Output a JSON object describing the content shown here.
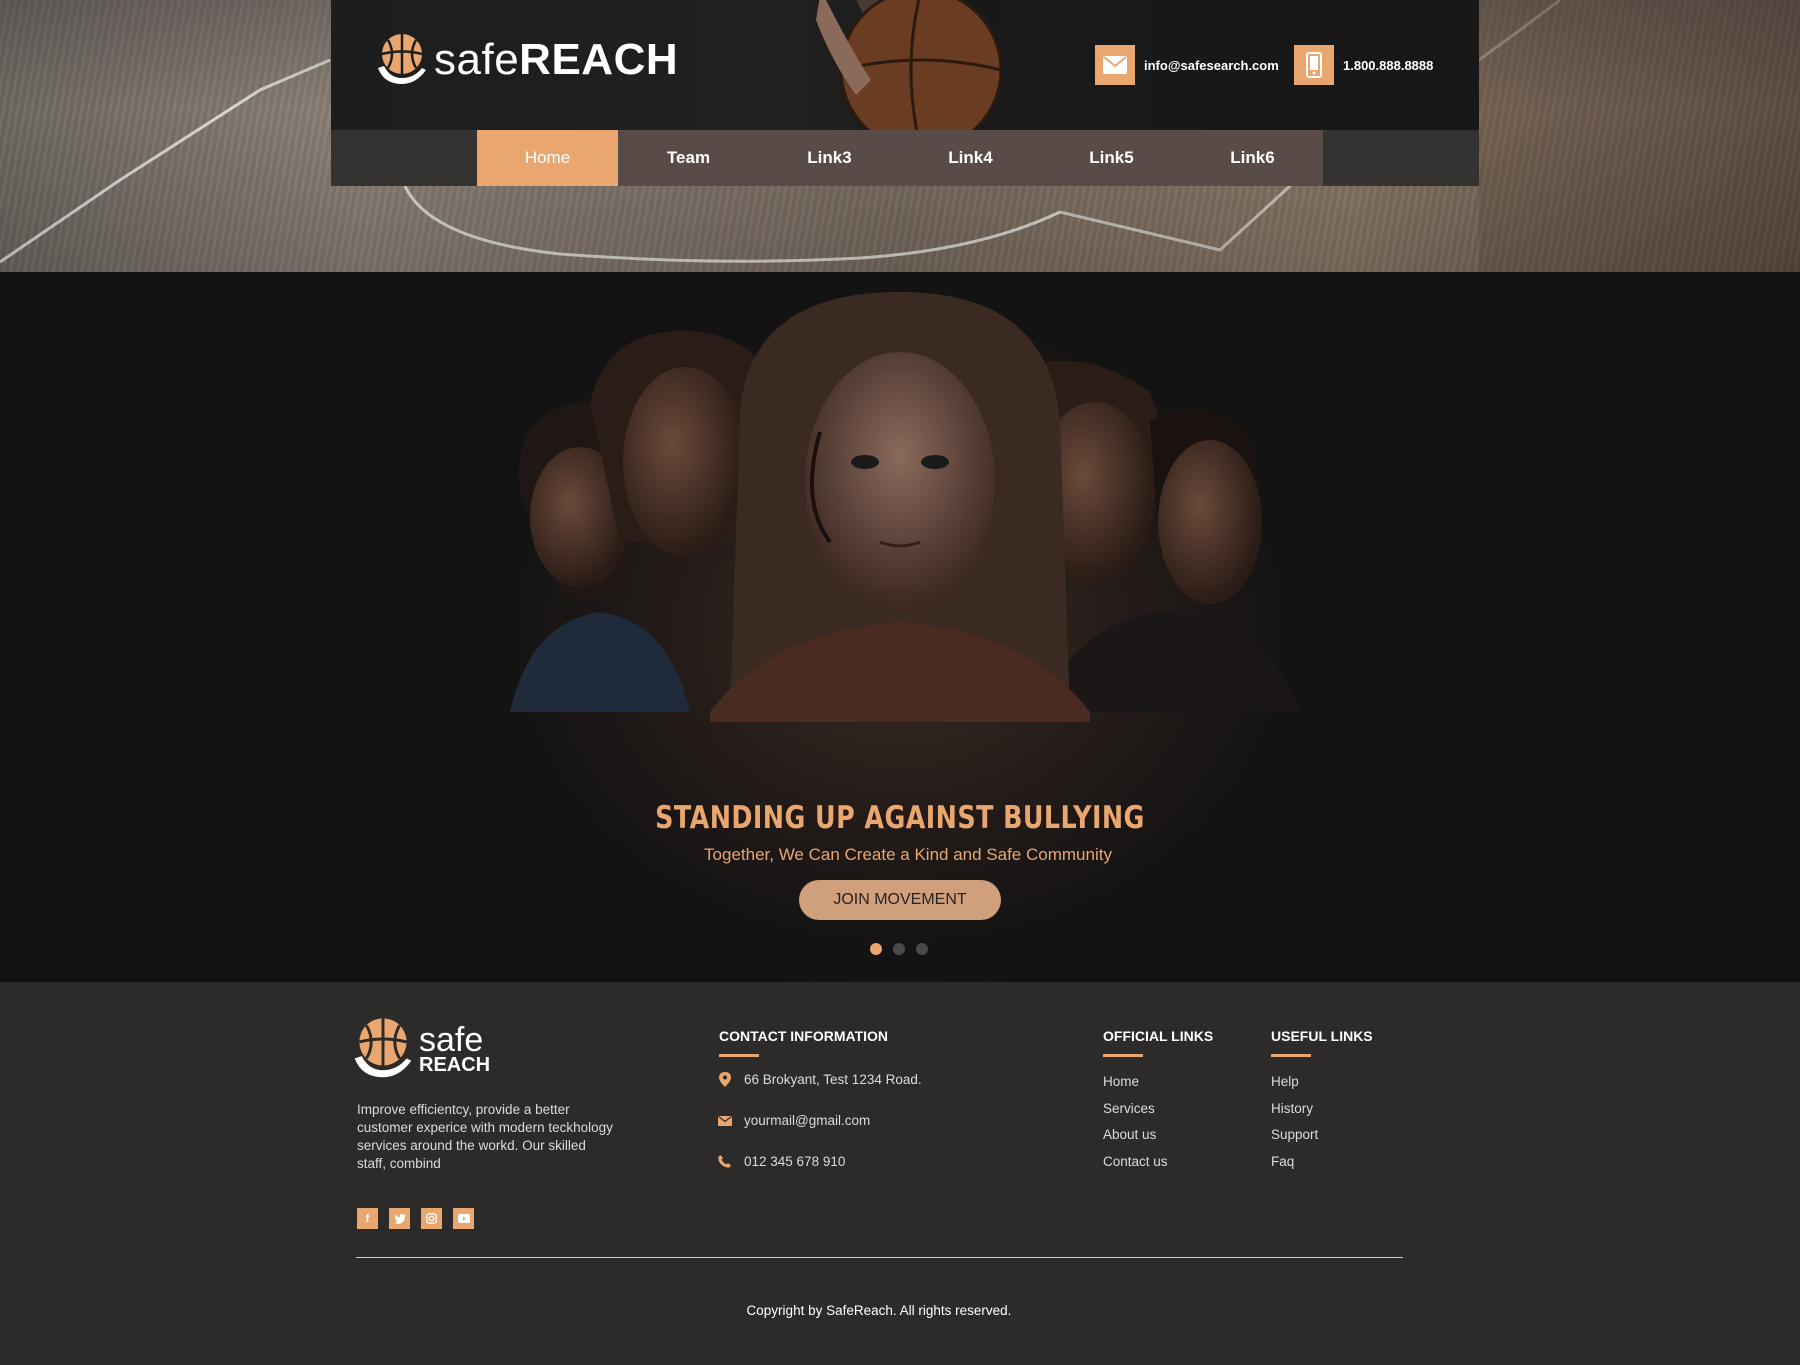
{
  "brand": {
    "name_light": "safe",
    "name_bold": "REACH",
    "footer_line1": "safe",
    "footer_line2": "REACH",
    "accent_color": "#e9a66f"
  },
  "header": {
    "email": "info@safesearch.com",
    "phone": "1.800.888.8888",
    "email_icon": "envelope-icon",
    "phone_icon": "mobile-phone-icon"
  },
  "nav": {
    "items": [
      {
        "label": "Home",
        "active": true
      },
      {
        "label": "Team",
        "active": false
      },
      {
        "label": "Link3",
        "active": false
      },
      {
        "label": "Link4",
        "active": false
      },
      {
        "label": "Link5",
        "active": false
      },
      {
        "label": "Link6",
        "active": false
      }
    ]
  },
  "hero": {
    "title": "STANDING UP AGAINST BULLYING",
    "subtitle": "Together, We Can Create a Kind and Safe Community",
    "button": "JOIN MOVEMENT",
    "slides": 3,
    "active_slide": 1
  },
  "footer": {
    "about": "Improve efficientcy, provide a better customer experice with modern teckhology services around the workd. Our skilled staff, combind",
    "socials": [
      "facebook-icon",
      "twitter-icon",
      "instagram-icon",
      "youtube-icon"
    ],
    "contact": {
      "heading": "CONTACT INFORMATION",
      "address": "66 Brokyant, Test 1234 Road.",
      "email": "yourmail@gmail.com",
      "phone": "012 345 678 910"
    },
    "official_links": {
      "heading": "OFFICIAL LINKS",
      "items": [
        "Home",
        "Services",
        "About us",
        "Contact us"
      ]
    },
    "useful_links": {
      "heading": "USEFUL LINKS",
      "items": [
        "Help",
        "History",
        "Support",
        "Faq"
      ]
    },
    "copyright": "Copyright by SafeReach. All rights reserved."
  }
}
